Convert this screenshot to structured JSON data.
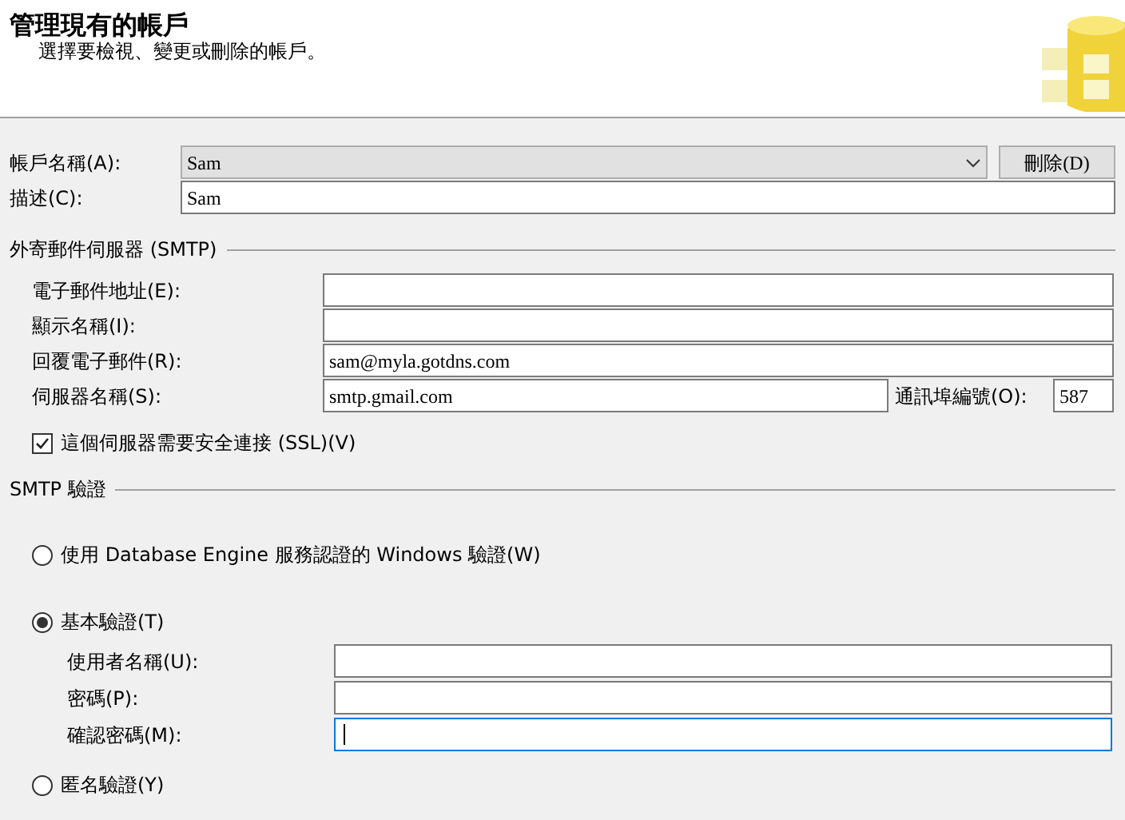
{
  "header": {
    "title": "管理現有的帳戶",
    "subtitle": "選擇要檢視、變更或刪除的帳戶。"
  },
  "account": {
    "name_label": "帳戶名稱(A):",
    "name_value": "Sam",
    "delete_button": "刪除(D)",
    "description_label": "描述(C):",
    "description_value": "Sam"
  },
  "smtp_server": {
    "heading": "外寄郵件伺服器 (SMTP)",
    "fields": [
      {
        "label": "電子郵件地址(E):"
      },
      {
        "label": "顯示名稱(I):"
      },
      {
        "label": "回覆電子郵件(R):",
        "value": "sam@myla.gotdns.com"
      }
    ],
    "server_name": {
      "label": "伺服器名稱(S):",
      "value": "smtp.gmail.com"
    },
    "port": {
      "label": "通訊埠編號(O):",
      "value": "587"
    },
    "ssl": {
      "label": "這個伺服器需要安全連接 (SSL)(V)",
      "checked": true
    }
  },
  "smtp_auth": {
    "heading": "SMTP 驗證",
    "options": [
      {
        "label": "使用 Database Engine 服務認證的 Windows 驗證(W)",
        "selected": false
      },
      {
        "label": "基本驗證(T)",
        "selected": true,
        "fields": [
          {
            "label": "使用者名稱(U):",
            "focused": false
          },
          {
            "label": "密碼(P):",
            "focused": false
          },
          {
            "label": "確認密碼(M):",
            "focused": true
          }
        ]
      },
      {
        "label": "匿名驗證(Y)",
        "selected": false
      }
    ]
  }
}
